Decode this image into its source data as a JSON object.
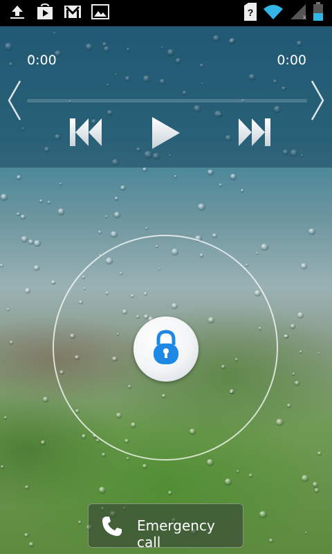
{
  "status_bar": {
    "left_icons": [
      "upload-icon",
      "play-store-icon",
      "gmail-icon",
      "gallery-icon"
    ],
    "right_icons": [
      "sim-unknown-icon",
      "wifi-icon",
      "cell-signal-off-icon",
      "battery-icon"
    ],
    "accent_color": "#33b5e5"
  },
  "media": {
    "time_start": "0:00",
    "time_end": "0:00",
    "progress": 0,
    "controls": [
      "previous-icon",
      "play-icon",
      "next-icon"
    ]
  },
  "lock": {
    "icon": "padlock-icon",
    "accent_color": "#1e88e5"
  },
  "emergency": {
    "label": "Emergency call",
    "icon": "phone-icon"
  }
}
